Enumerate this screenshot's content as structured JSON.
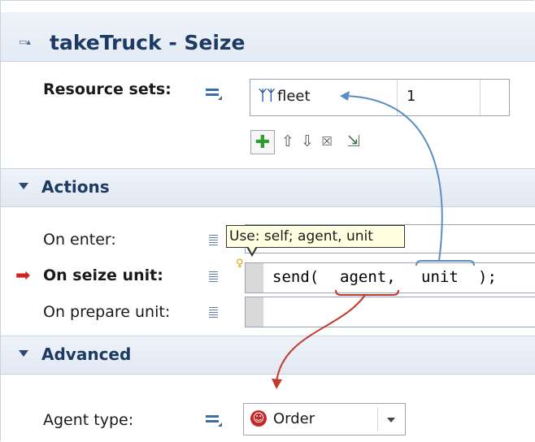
{
  "header": {
    "icon": "▭▴",
    "title": "takeTruck - Seize"
  },
  "resource_sets": {
    "label": "Resource sets:",
    "row": {
      "icon": "resource-pool-icon",
      "name": "fleet",
      "count": "1"
    },
    "toolbar": [
      "add-icon",
      "move-up-icon",
      "move-down-icon",
      "delete-icon",
      "select-resource-icon"
    ]
  },
  "sections": {
    "actions": "Actions",
    "advanced": "Advanced"
  },
  "actions": {
    "on_enter": {
      "label": "On enter:",
      "value": ""
    },
    "on_seize_unit": {
      "label": "On seize unit:",
      "code_prefix": "send(",
      "arg1": "agent,",
      "arg2": "unit",
      "code_suffix": ");"
    },
    "on_prepare_unit": {
      "label": "On prepare unit:",
      "value": ""
    }
  },
  "tooltip": "Use: self; agent, unit",
  "advanced": {
    "agent_type": {
      "label": "Agent type:",
      "value": "Order"
    }
  },
  "colors": {
    "header_text": "#1d3a63",
    "blue_arrow": "#5b8ec4",
    "red_arrow": "#c0392b",
    "green_add": "#2e9b2e"
  }
}
